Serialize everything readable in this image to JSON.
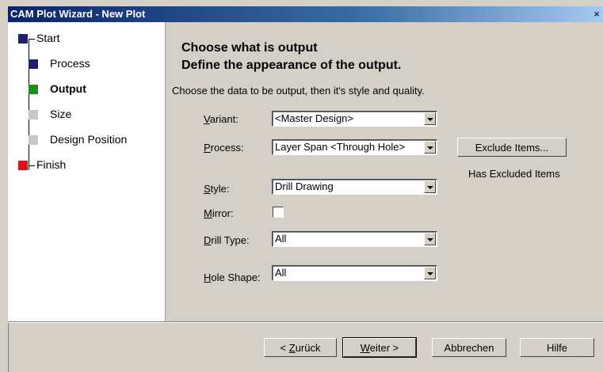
{
  "window": {
    "title": "CAM Plot  Wizard - New Plot",
    "close_glyph": "×"
  },
  "steps": [
    {
      "label": "Start",
      "color": "#1f1f6e"
    },
    {
      "label": "Process",
      "color": "#1f1f6e"
    },
    {
      "label": "Output",
      "color": "#1a8f1a"
    },
    {
      "label": "Size",
      "color": "#c8c8c8"
    },
    {
      "label": "Design Position",
      "color": "#c8c8c8"
    },
    {
      "label": "Finish",
      "color": "#e01010"
    }
  ],
  "main": {
    "heading1": "Choose what is output",
    "heading2": "Define the appearance of the output.",
    "description": "Choose the data to be output, then it's style and quality."
  },
  "form": {
    "variant": {
      "label_u": "V",
      "label_rest": "ariant:",
      "value": "<Master Design>"
    },
    "process": {
      "label_u": "P",
      "label_rest": "rocess:",
      "value": "Layer Span <Through Hole>"
    },
    "style": {
      "label_u": "S",
      "label_rest": "tyle:",
      "value": "Drill Drawing"
    },
    "mirror": {
      "label_u": "M",
      "label_rest": "irror:",
      "checked": false
    },
    "drill_type": {
      "label_u": "D",
      "label_rest": "rill Type:",
      "value": "All"
    },
    "hole_shape": {
      "label_u": "H",
      "label_rest": "ole Shape:",
      "value": "All"
    }
  },
  "exclude": {
    "button": "Exclude Items...",
    "status": "Has Excluded Items"
  },
  "footer": {
    "back_pre": "< ",
    "back_u": "Z",
    "back_rest": "urück",
    "next_u": "W",
    "next_rest": "eiter >",
    "cancel": "Abbrechen",
    "help": "Hilfe"
  }
}
